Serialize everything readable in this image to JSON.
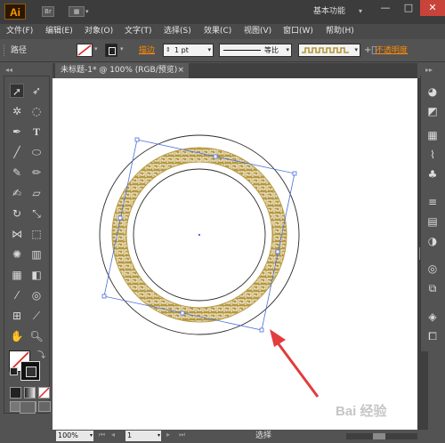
{
  "app": {
    "logo": "Ai",
    "workspace": "基本功能",
    "window_controls": [
      "—",
      "□",
      "✕"
    ]
  },
  "menu": [
    "文件(F)",
    "编辑(E)",
    "对象(O)",
    "文字(T)",
    "选择(S)",
    "效果(C)",
    "视图(V)",
    "窗口(W)",
    "帮助(H)"
  ],
  "control": {
    "label": "路径",
    "stroke_label": "描边",
    "stroke_weight": "1 pt",
    "profile": "等比",
    "opacity_label": "不透明度"
  },
  "document": {
    "tab_title": "未标题-1* @ 100% (RGB/预览)",
    "close": "×"
  },
  "status": {
    "zoom": "100%",
    "artboard": "1",
    "tool": "选择"
  },
  "watermark": "Bai 经验",
  "colors": {
    "accent": "#ff8a00",
    "pattern": "#b5973d",
    "selection": "#4d6fd6",
    "arrow": "#e23c3c"
  }
}
